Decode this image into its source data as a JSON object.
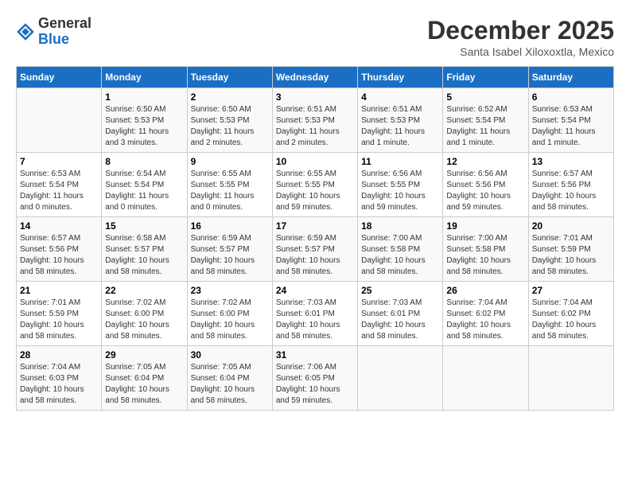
{
  "header": {
    "logo_general": "General",
    "logo_blue": "Blue",
    "month_title": "December 2025",
    "location": "Santa Isabel Xiloxoxtla, Mexico"
  },
  "weekdays": [
    "Sunday",
    "Monday",
    "Tuesday",
    "Wednesday",
    "Thursday",
    "Friday",
    "Saturday"
  ],
  "weeks": [
    [
      {
        "day": "",
        "info": ""
      },
      {
        "day": "1",
        "info": "Sunrise: 6:50 AM\nSunset: 5:53 PM\nDaylight: 11 hours\nand 3 minutes."
      },
      {
        "day": "2",
        "info": "Sunrise: 6:50 AM\nSunset: 5:53 PM\nDaylight: 11 hours\nand 2 minutes."
      },
      {
        "day": "3",
        "info": "Sunrise: 6:51 AM\nSunset: 5:53 PM\nDaylight: 11 hours\nand 2 minutes."
      },
      {
        "day": "4",
        "info": "Sunrise: 6:51 AM\nSunset: 5:53 PM\nDaylight: 11 hours\nand 1 minute."
      },
      {
        "day": "5",
        "info": "Sunrise: 6:52 AM\nSunset: 5:54 PM\nDaylight: 11 hours\nand 1 minute."
      },
      {
        "day": "6",
        "info": "Sunrise: 6:53 AM\nSunset: 5:54 PM\nDaylight: 11 hours\nand 1 minute."
      }
    ],
    [
      {
        "day": "7",
        "info": "Sunrise: 6:53 AM\nSunset: 5:54 PM\nDaylight: 11 hours\nand 0 minutes."
      },
      {
        "day": "8",
        "info": "Sunrise: 6:54 AM\nSunset: 5:54 PM\nDaylight: 11 hours\nand 0 minutes."
      },
      {
        "day": "9",
        "info": "Sunrise: 6:55 AM\nSunset: 5:55 PM\nDaylight: 11 hours\nand 0 minutes."
      },
      {
        "day": "10",
        "info": "Sunrise: 6:55 AM\nSunset: 5:55 PM\nDaylight: 10 hours\nand 59 minutes."
      },
      {
        "day": "11",
        "info": "Sunrise: 6:56 AM\nSunset: 5:55 PM\nDaylight: 10 hours\nand 59 minutes."
      },
      {
        "day": "12",
        "info": "Sunrise: 6:56 AM\nSunset: 5:56 PM\nDaylight: 10 hours\nand 59 minutes."
      },
      {
        "day": "13",
        "info": "Sunrise: 6:57 AM\nSunset: 5:56 PM\nDaylight: 10 hours\nand 58 minutes."
      }
    ],
    [
      {
        "day": "14",
        "info": "Sunrise: 6:57 AM\nSunset: 5:56 PM\nDaylight: 10 hours\nand 58 minutes."
      },
      {
        "day": "15",
        "info": "Sunrise: 6:58 AM\nSunset: 5:57 PM\nDaylight: 10 hours\nand 58 minutes."
      },
      {
        "day": "16",
        "info": "Sunrise: 6:59 AM\nSunset: 5:57 PM\nDaylight: 10 hours\nand 58 minutes."
      },
      {
        "day": "17",
        "info": "Sunrise: 6:59 AM\nSunset: 5:57 PM\nDaylight: 10 hours\nand 58 minutes."
      },
      {
        "day": "18",
        "info": "Sunrise: 7:00 AM\nSunset: 5:58 PM\nDaylight: 10 hours\nand 58 minutes."
      },
      {
        "day": "19",
        "info": "Sunrise: 7:00 AM\nSunset: 5:58 PM\nDaylight: 10 hours\nand 58 minutes."
      },
      {
        "day": "20",
        "info": "Sunrise: 7:01 AM\nSunset: 5:59 PM\nDaylight: 10 hours\nand 58 minutes."
      }
    ],
    [
      {
        "day": "21",
        "info": "Sunrise: 7:01 AM\nSunset: 5:59 PM\nDaylight: 10 hours\nand 58 minutes."
      },
      {
        "day": "22",
        "info": "Sunrise: 7:02 AM\nSunset: 6:00 PM\nDaylight: 10 hours\nand 58 minutes."
      },
      {
        "day": "23",
        "info": "Sunrise: 7:02 AM\nSunset: 6:00 PM\nDaylight: 10 hours\nand 58 minutes."
      },
      {
        "day": "24",
        "info": "Sunrise: 7:03 AM\nSunset: 6:01 PM\nDaylight: 10 hours\nand 58 minutes."
      },
      {
        "day": "25",
        "info": "Sunrise: 7:03 AM\nSunset: 6:01 PM\nDaylight: 10 hours\nand 58 minutes."
      },
      {
        "day": "26",
        "info": "Sunrise: 7:04 AM\nSunset: 6:02 PM\nDaylight: 10 hours\nand 58 minutes."
      },
      {
        "day": "27",
        "info": "Sunrise: 7:04 AM\nSunset: 6:02 PM\nDaylight: 10 hours\nand 58 minutes."
      }
    ],
    [
      {
        "day": "28",
        "info": "Sunrise: 7:04 AM\nSunset: 6:03 PM\nDaylight: 10 hours\nand 58 minutes."
      },
      {
        "day": "29",
        "info": "Sunrise: 7:05 AM\nSunset: 6:04 PM\nDaylight: 10 hours\nand 58 minutes."
      },
      {
        "day": "30",
        "info": "Sunrise: 7:05 AM\nSunset: 6:04 PM\nDaylight: 10 hours\nand 58 minutes."
      },
      {
        "day": "31",
        "info": "Sunrise: 7:06 AM\nSunset: 6:05 PM\nDaylight: 10 hours\nand 59 minutes."
      },
      {
        "day": "",
        "info": ""
      },
      {
        "day": "",
        "info": ""
      },
      {
        "day": "",
        "info": ""
      }
    ]
  ]
}
